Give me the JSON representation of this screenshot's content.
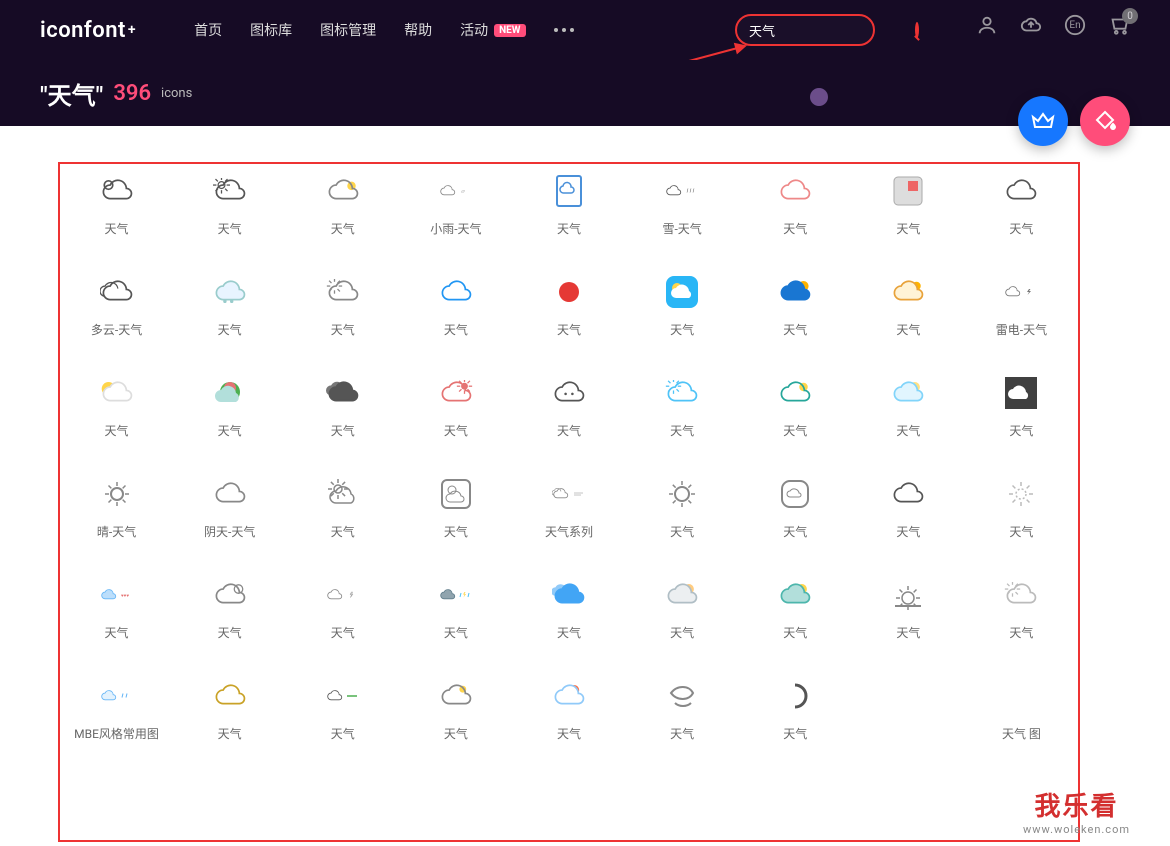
{
  "header": {
    "logo": "iconfont",
    "logo_plus": "+",
    "nav": [
      "首页",
      "图标库",
      "图标管理",
      "帮助",
      "活动"
    ],
    "nav_badge": "NEW",
    "search_value": "天气",
    "lang": "En",
    "cart_count": "0"
  },
  "subheader": {
    "query": "\"天气\"",
    "count": "396",
    "count_label": "icons"
  },
  "icons_row1": [
    {
      "name": "cloud-sun-outline",
      "label": "天气"
    },
    {
      "name": "sun-cloud-outline",
      "label": "天气"
    },
    {
      "name": "partly-sunny-outline",
      "label": "天气"
    },
    {
      "name": "drizzle-cloud",
      "label": "小雨-天气"
    },
    {
      "name": "weather-document",
      "label": "天气"
    },
    {
      "name": "rain-cloud-outline",
      "label": "雪-天气"
    },
    {
      "name": "cloud-outline-pink",
      "label": "天气"
    },
    {
      "name": "weather-app-square",
      "label": "天气"
    },
    {
      "name": "cloud-outline",
      "label": "天气"
    }
  ],
  "icons_row2": [
    {
      "name": "cloudy-outline",
      "label": "多云-天气"
    },
    {
      "name": "snow-color",
      "label": "天气"
    },
    {
      "name": "sun-behind-cloud",
      "label": "天气"
    },
    {
      "name": "cloud-blue-outline",
      "label": "天气"
    },
    {
      "name": "sun-red-solid",
      "label": "天气"
    },
    {
      "name": "weather-app-icon",
      "label": "天气"
    },
    {
      "name": "cloud-blue-solid",
      "label": "天气"
    },
    {
      "name": "sun-cloud-color",
      "label": "天气"
    },
    {
      "name": "thunder-cloud",
      "label": "雷电-天气"
    }
  ],
  "icons_row3": [
    {
      "name": "sun-cloud-yellow",
      "label": "天气"
    },
    {
      "name": "rainbow-cloud",
      "label": "天气"
    },
    {
      "name": "clouds-dark-solid",
      "label": "天气"
    },
    {
      "name": "sun-cloud-red",
      "label": "天气"
    },
    {
      "name": "cloud-face-outline",
      "label": "天气"
    },
    {
      "name": "sun-cloud-lightblue",
      "label": "天气"
    },
    {
      "name": "cloud-teal-outline",
      "label": "天气"
    },
    {
      "name": "moon-cloud-color",
      "label": "天气"
    },
    {
      "name": "cloud-dark-square",
      "label": "天气"
    }
  ],
  "icons_row4": [
    {
      "name": "sun-outline",
      "label": "晴-天气"
    },
    {
      "name": "cloud-simple-outline",
      "label": "阴天-天气"
    },
    {
      "name": "sun-rays-outline",
      "label": "天气"
    },
    {
      "name": "weather-card-outline",
      "label": "天气"
    },
    {
      "name": "wind-clouds-outline",
      "label": "天气系列"
    },
    {
      "name": "sun-gear-outline",
      "label": "天气"
    },
    {
      "name": "weather-rounded-square",
      "label": "天气"
    },
    {
      "name": "cloud-bold-outline",
      "label": "天气"
    },
    {
      "name": "sun-dotted-outline",
      "label": "天气"
    }
  ],
  "icons_row5": [
    {
      "name": "rain-hearts-color",
      "label": "天气"
    },
    {
      "name": "sun-behind-cloud-2",
      "label": "天气"
    },
    {
      "name": "lightning-cloud-outline",
      "label": "天气"
    },
    {
      "name": "storm-color",
      "label": "天气"
    },
    {
      "name": "clouds-blue-solid",
      "label": "天气"
    },
    {
      "name": "sun-cloud-flat",
      "label": "天气"
    },
    {
      "name": "sun-cloud-teal-flat",
      "label": "天气"
    },
    {
      "name": "sunrise-outline",
      "label": "天气"
    },
    {
      "name": "sun-cloud-light",
      "label": "天气"
    }
  ],
  "icons_row6": [
    {
      "name": "rain-cloud-blue",
      "label": "MBE风格常用图"
    },
    {
      "name": "cloud-yellow-outline",
      "label": "天气"
    },
    {
      "name": "cloud-green-underline",
      "label": "天气"
    },
    {
      "name": "sun-cloud-tiny",
      "label": "天气"
    },
    {
      "name": "sunset-cloud-color",
      "label": "天气"
    },
    {
      "name": "wind-swirl-outline",
      "label": "天气"
    },
    {
      "name": "half-loader",
      "label": "天气"
    },
    {
      "name": "blank",
      "label": ""
    },
    {
      "name": "blank2",
      "label": "天气 图"
    }
  ],
  "watermark": {
    "line1": "我乐看",
    "line2": "www.woleken.com"
  }
}
